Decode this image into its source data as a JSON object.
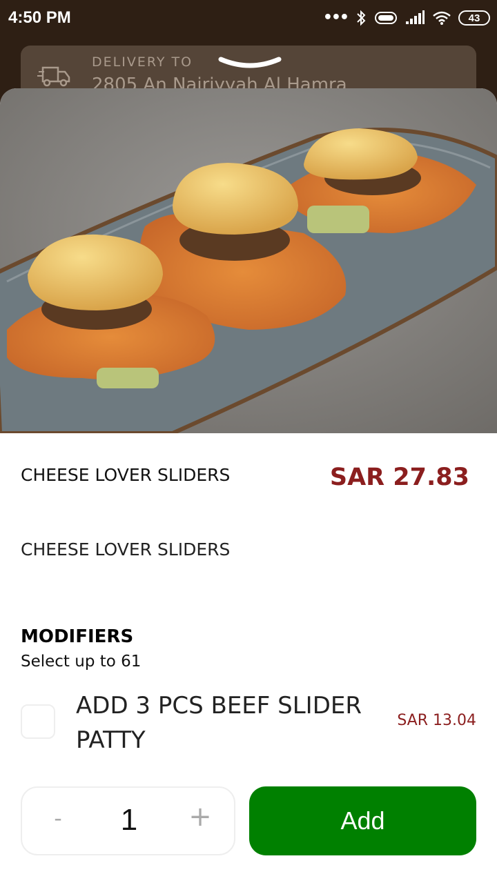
{
  "status_bar": {
    "time": "4:50 PM",
    "signal_dots": "•••",
    "battery": "43",
    "icons": [
      "bluetooth-icon",
      "vibrate-icon",
      "signal-icon",
      "wifi-icon",
      "battery-icon"
    ]
  },
  "delivery": {
    "label": "DELIVERY TO",
    "address": "2805 An Nairiyyah Al Hamra",
    "icon": "delivery-truck-icon"
  },
  "item": {
    "title": "CHEESE LOVER SLIDERS",
    "price": "SAR 27.83",
    "description": "CHEESE LOVER SLIDERS",
    "image_alt_icon": "food-photo"
  },
  "modifiers": {
    "title": "MODIFIERS",
    "subtitle": "Select up to 61",
    "options": [
      {
        "name": "ADD 3 PCS BEEF SLIDER PATTY",
        "price": "SAR 13.04",
        "checked": false
      }
    ]
  },
  "order": {
    "minus": "-",
    "quantity": "1",
    "plus": "+",
    "add_label": "Add"
  },
  "colors": {
    "header_bg": "#2e1f14",
    "price": "#8b1e1e",
    "add_button": "#008000"
  }
}
